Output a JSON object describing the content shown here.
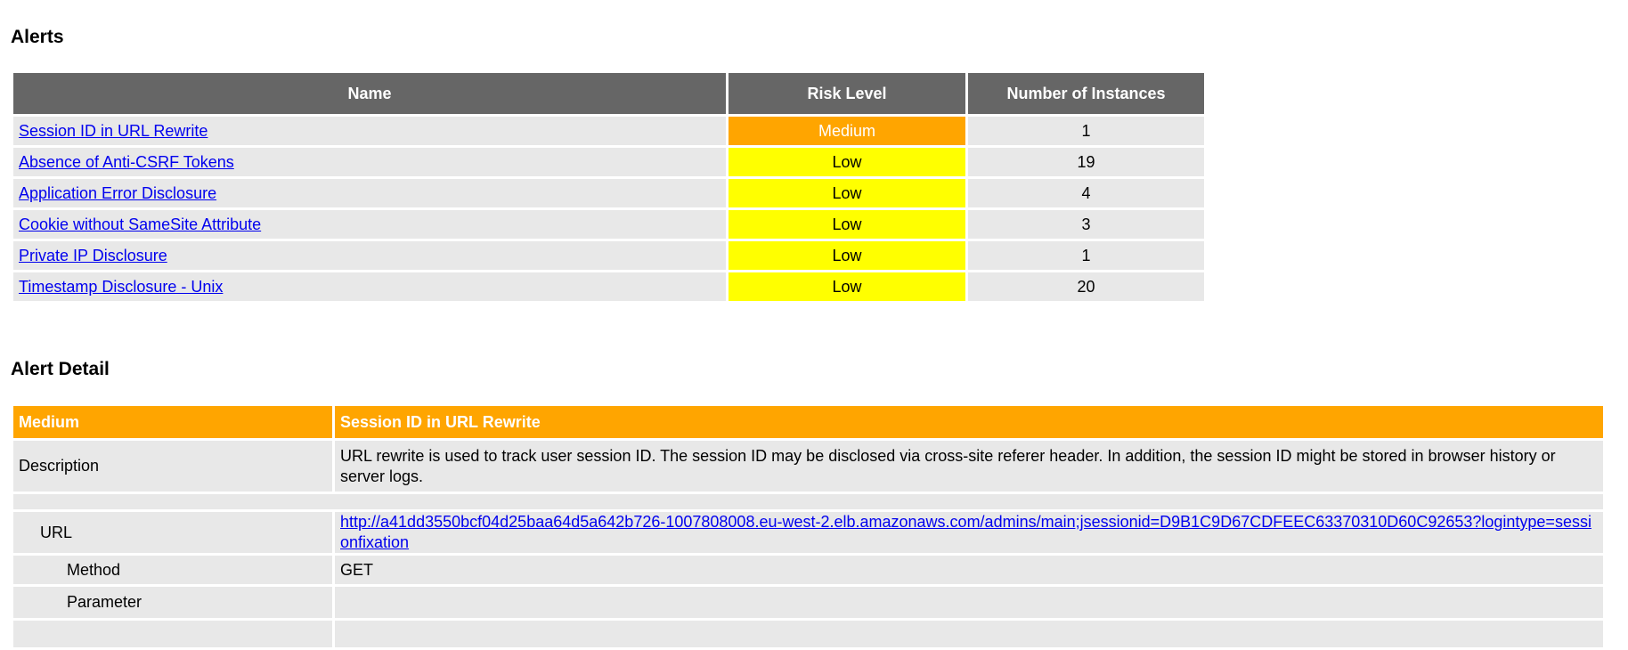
{
  "alerts": {
    "title": "Alerts",
    "headers": {
      "name": "Name",
      "risk": "Risk Level",
      "count": "Number of Instances"
    },
    "rows": [
      {
        "name": "Session ID in URL Rewrite",
        "risk": "Medium",
        "count": "1"
      },
      {
        "name": "Absence of Anti-CSRF Tokens",
        "risk": "Low",
        "count": "19"
      },
      {
        "name": "Application Error Disclosure",
        "risk": "Low",
        "count": "4"
      },
      {
        "name": "Cookie without SameSite Attribute",
        "risk": "Low",
        "count": "3"
      },
      {
        "name": "Private IP Disclosure",
        "risk": "Low",
        "count": "1"
      },
      {
        "name": "Timestamp Disclosure - Unix",
        "risk": "Low",
        "count": "20"
      }
    ]
  },
  "detail": {
    "title": "Alert Detail",
    "risk": "Medium",
    "name": "Session ID in URL Rewrite",
    "description_label": "Description",
    "description": "URL rewrite is used to track user session ID. The session ID may be disclosed via cross-site referer header. In addition, the session ID might be stored in browser history or server logs.",
    "url_label": "URL",
    "url": "http://a41dd3550bcf04d25baa64d5a642b726-1007808008.eu-west-2.elb.amazonaws.com/admins/main;jsessionid=D9B1C9D67CDFEEC63370310D60C92653?logintype=sessionfixation",
    "method_label": "Method",
    "method": "GET",
    "parameter_label": "Parameter",
    "parameter": ""
  },
  "colors": {
    "medium": "#ffa500",
    "low": "#ffff00",
    "header": "#666666",
    "row": "#e8e8e8"
  }
}
